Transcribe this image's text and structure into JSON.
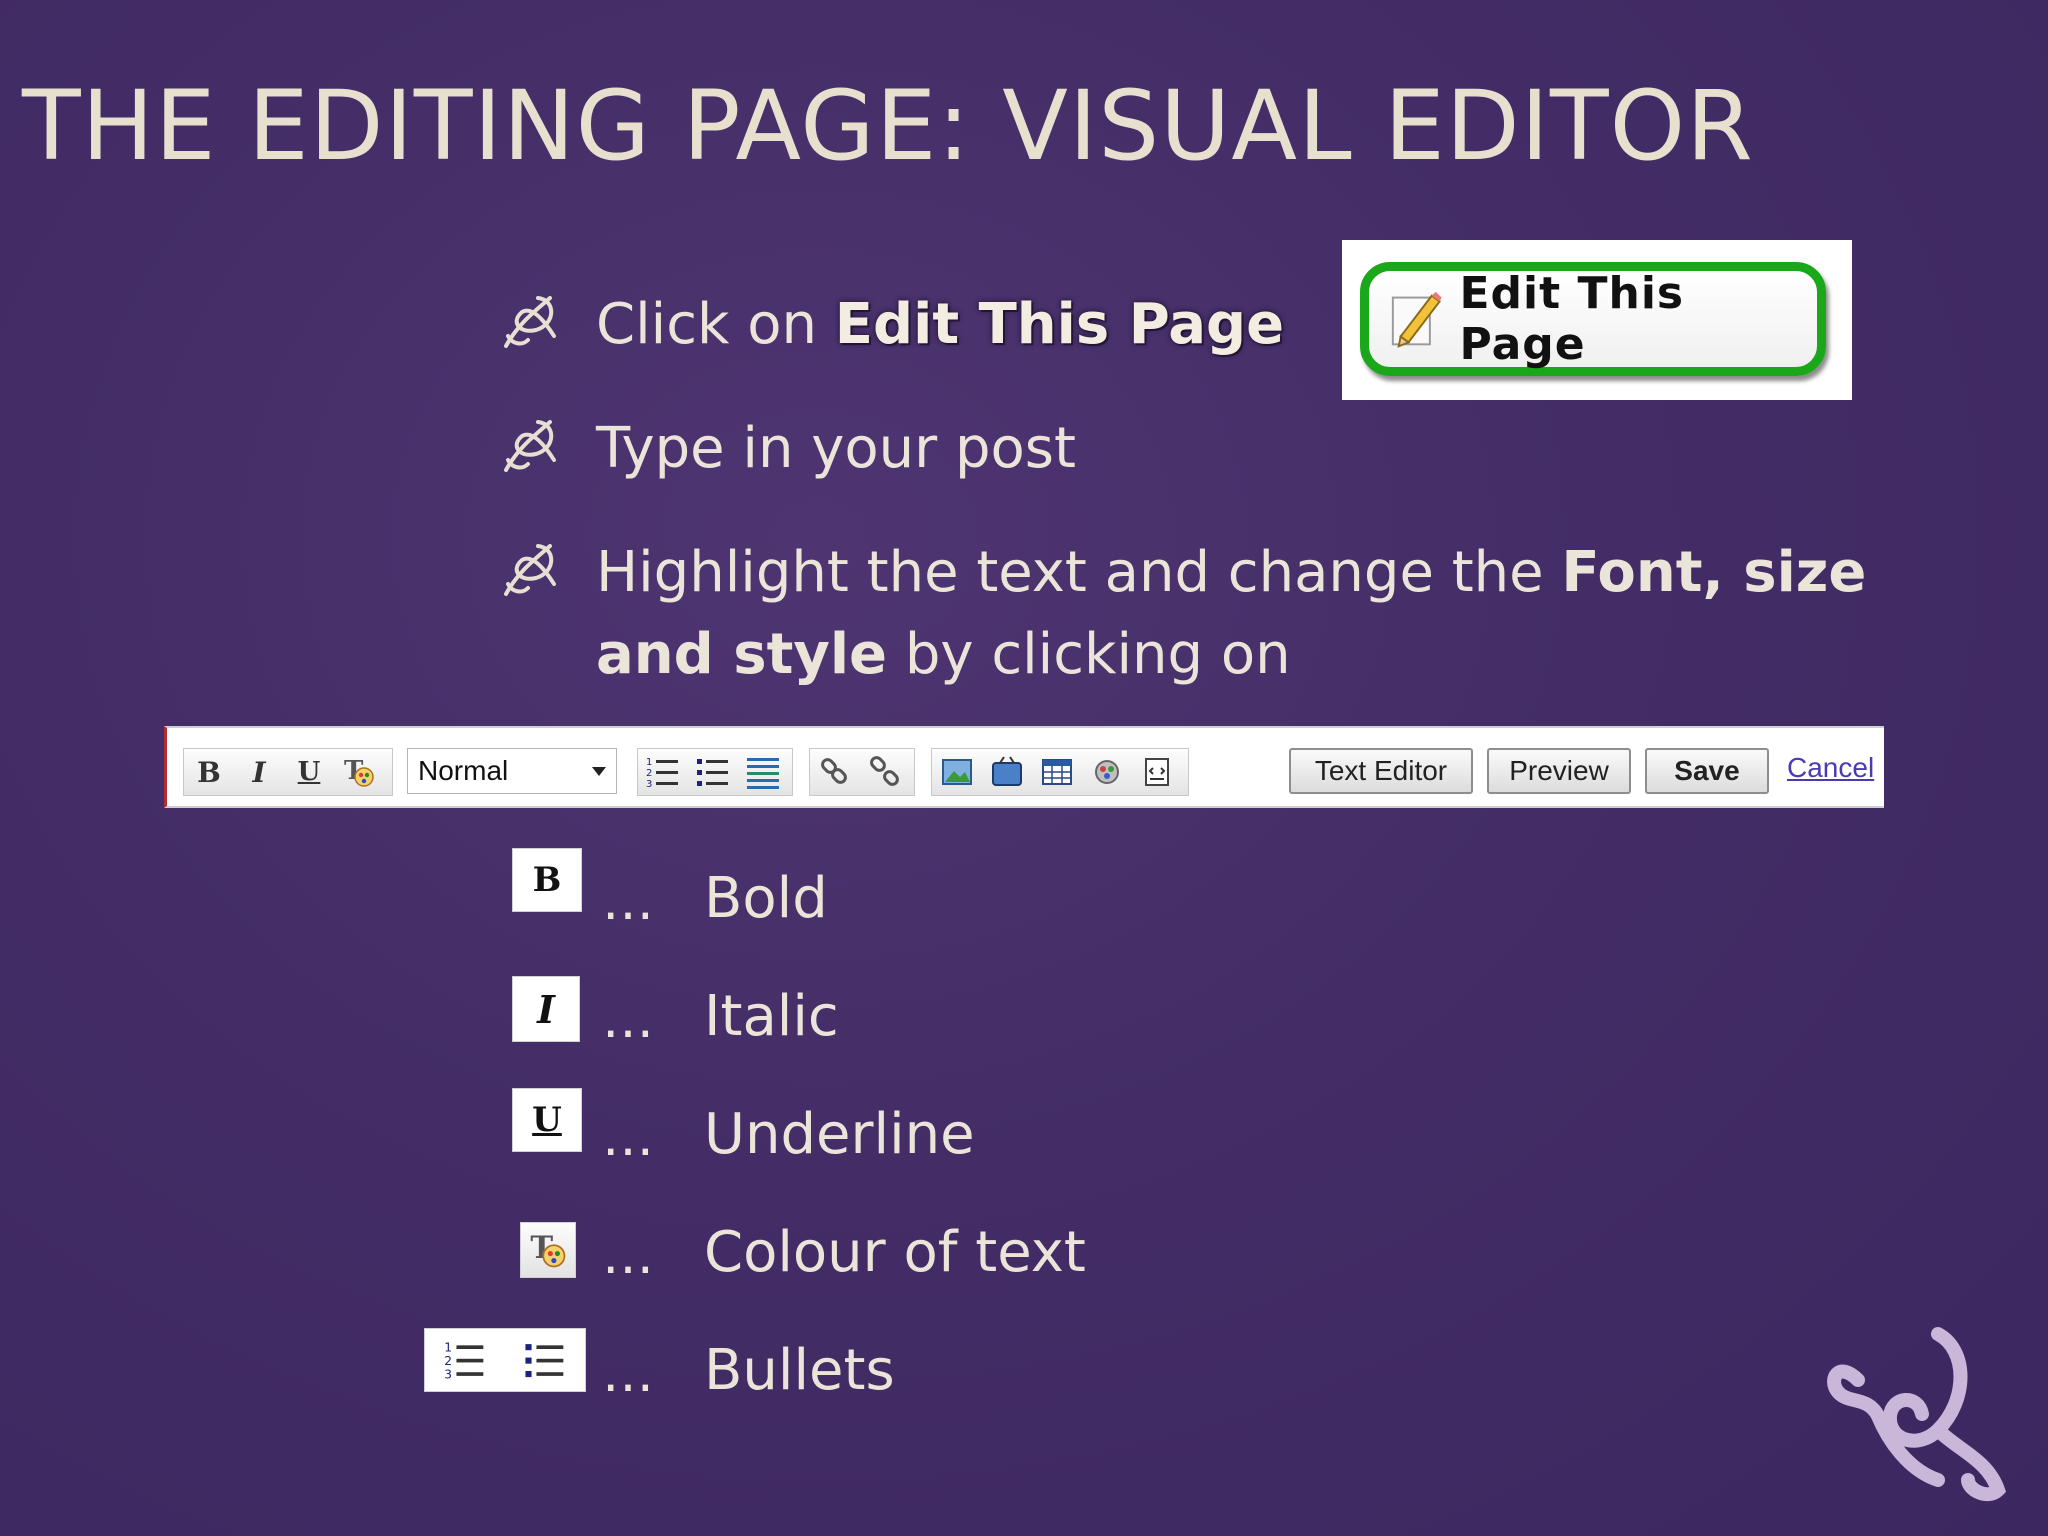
{
  "slide": {
    "title": "THE EDITING PAGE: VISUAL EDITOR"
  },
  "bullets": [
    {
      "prefix": "Click on ",
      "highlight": "Edit This Page"
    },
    {
      "text": "Type in your post"
    },
    {
      "prefix": "Highlight the text and change the ",
      "strong": "Font, size and style",
      "suffix": " by clicking on"
    }
  ],
  "edit_button": {
    "label": "Edit This Page",
    "border_color": "#1aa81a",
    "icon": "pencil-icon"
  },
  "toolbar": {
    "format_icons": [
      "bold-icon",
      "italic-icon",
      "underline-icon",
      "text-color-icon"
    ],
    "bold_label": "B",
    "italic_label": "I",
    "underline_label": "U",
    "font_select_value": "Normal",
    "list_icons": [
      "numbered-list-icon",
      "bullet-list-icon",
      "indent-icon"
    ],
    "link_icons": [
      "link-icon",
      "unlink-icon"
    ],
    "insert_icons": [
      "image-icon",
      "video-icon",
      "table-icon",
      "plugin-icon",
      "html-icon"
    ],
    "text_editor_label": "Text Editor",
    "preview_label": "Preview",
    "save_label": "Save",
    "cancel_label": "Cancel"
  },
  "legend": {
    "ellipsis": "…",
    "items": [
      {
        "icon": "bold-icon",
        "icon_text": "B",
        "label": "Bold"
      },
      {
        "icon": "italic-icon",
        "icon_text": "I",
        "label": "Italic"
      },
      {
        "icon": "underline-icon",
        "icon_text": "U",
        "label": "Underline"
      },
      {
        "icon": "text-color-icon",
        "label": "Colour of text"
      },
      {
        "icon": "list-icons",
        "label": "Bullets"
      }
    ]
  },
  "colors": {
    "background": "#442d66",
    "title": "#e8e0cf",
    "text": "#ebe4d8",
    "accent_green": "#1aa81a",
    "link": "#4b3bb3"
  }
}
